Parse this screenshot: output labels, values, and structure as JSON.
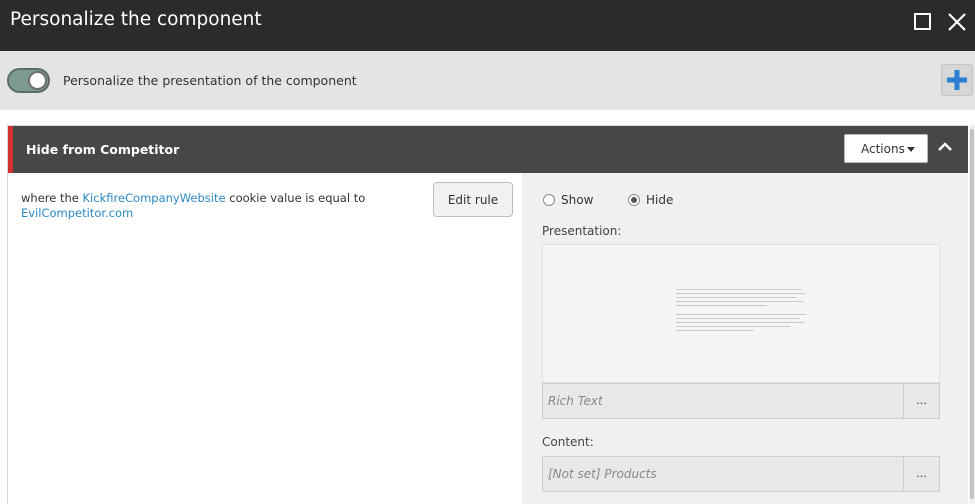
{
  "dialog": {
    "title": "Personalize the component"
  },
  "toolbar": {
    "toggle_label": "Personalize the presentation of the component",
    "toggle_on": true
  },
  "rule": {
    "title": "Hide from Competitor",
    "accent_color": "#d42f2f",
    "actions_label": "Actions",
    "condition_prefix": "where the ",
    "condition_link1": "KickfireCompanyWebsite",
    "condition_middle": " cookie value is equal to",
    "condition_link2": "EvilCompetitor.com",
    "edit_rule_label": "Edit rule",
    "show_label": "Show",
    "hide_label": "Hide",
    "selected_action": "Hide",
    "presentation_label": "Presentation:",
    "presentation_value": "Rich Text",
    "content_label": "Content:",
    "content_value": "[Not set] Products",
    "more_label": "..."
  },
  "icons": {
    "maximize": "maximize-icon",
    "close": "close-icon",
    "add": "plus-icon",
    "collapse": "chevron-up-icon"
  },
  "colors": {
    "titlebar": "#2b2b2b",
    "rule_header": "#474747",
    "link": "#2b89c6",
    "add_icon": "#2b7fd0"
  }
}
